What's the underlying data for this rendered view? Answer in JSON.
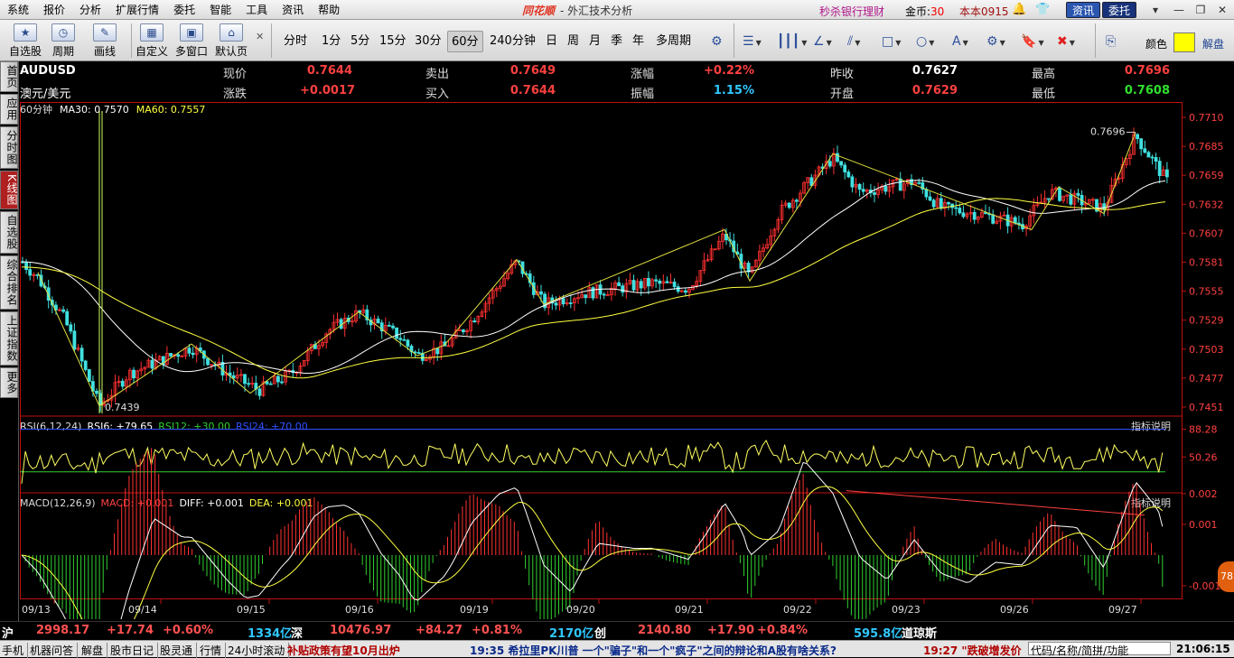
{
  "menu": {
    "items": [
      "系统",
      "报价",
      "分析",
      "扩展行情",
      "委托",
      "智能",
      "工具",
      "资讯",
      "帮助"
    ],
    "brand": "同花顺",
    "title": "- 外汇技术分析",
    "bank": "秒杀银行理财",
    "coins_label": "金币:",
    "coins_value": "30",
    "user": "本本0915",
    "btn_info": "资讯",
    "btn_trade": "委托"
  },
  "toolbar": {
    "big": [
      {
        "icon": "star-icon",
        "label": "自选股",
        "glyph": "★"
      },
      {
        "icon": "clock-icon",
        "label": "周期",
        "glyph": "◷"
      },
      {
        "icon": "pencil-icon",
        "label": "画线",
        "glyph": "✎"
      },
      {
        "icon": "grid-icon",
        "label": "自定义",
        "glyph": "▦"
      },
      {
        "icon": "windows-icon",
        "label": "多窗口",
        "glyph": "▣"
      },
      {
        "icon": "home-icon",
        "label": "默认页",
        "glyph": "⌂"
      }
    ],
    "periods": [
      "分时",
      "1分",
      "5分",
      "15分",
      "30分",
      "60分",
      "240分钟",
      "日",
      "周",
      "月",
      "季",
      "年",
      "多周期"
    ],
    "active_period": "60分",
    "color_label": "颜色",
    "color_value": "#ffff00",
    "unlock_label": "解盘"
  },
  "sidebar": [
    "首页",
    "应用",
    "分时图",
    "K线图",
    "自选股",
    "综合排名",
    "上证指数",
    "更多"
  ],
  "sidebar_active": "K线图",
  "quote": {
    "symbol": "AUDUSD",
    "name": "澳元/美元",
    "row1": [
      {
        "label": "现价",
        "value": "0.7644"
      },
      {
        "label": "卖出",
        "value": "0.7649"
      },
      {
        "label": "涨幅",
        "value": "+0.22%"
      },
      {
        "label": "昨收",
        "value": "0.7627"
      },
      {
        "label": "最高",
        "value": "0.7696"
      }
    ],
    "row2": [
      {
        "label": "涨跌",
        "value": "+0.0017"
      },
      {
        "label": "买入",
        "value": "0.7644"
      },
      {
        "label": "振幅",
        "value": "1.15%"
      },
      {
        "label": "开盘",
        "value": "0.7629"
      },
      {
        "label": "最低",
        "value": "0.7608"
      }
    ]
  },
  "main_chart": {
    "period_label": "60分钟",
    "ma30": "MA30: 0.7570",
    "ma60": "MA60: 0.7557",
    "y_ticks": [
      "0.7710",
      "0.7685",
      "0.7659",
      "0.7632",
      "0.7607",
      "0.7581",
      "0.7555",
      "0.7529",
      "0.7503",
      "0.7477",
      "0.7451"
    ],
    "high_label": "0.7696",
    "low_label": "0.7439",
    "x_ticks": [
      "09/13",
      "09/14",
      "09/15",
      "09/16",
      "09/19",
      "09/20",
      "09/21",
      "09/22",
      "09/23",
      "09/26",
      "09/27"
    ]
  },
  "rsi": {
    "title": "RSI(6,12,24)",
    "rsi6": "RSI6: +79.65",
    "rsi12": "RSI12: +30.00",
    "rsi24": "RSI24: +70.00",
    "y_ticks": [
      "88.28",
      "50.26"
    ],
    "explain": "指标说明"
  },
  "macd": {
    "title": "MACD(12,26,9)",
    "macd": "MACD: +0.001",
    "diff": "DIFF: +0.001",
    "dea": "DEA: +0.001",
    "y_ticks": [
      "0.002",
      "0.001",
      "-0.001"
    ],
    "explain": "指标说明"
  },
  "chart_data": {
    "type": "candlestick",
    "x_ticks": [
      "09/13",
      "09/14",
      "09/15",
      "09/16",
      "09/19",
      "09/20",
      "09/21",
      "09/22",
      "09/23",
      "09/26",
      "09/27"
    ],
    "ylim": [
      0.7439,
      0.771
    ],
    "high": 0.7696,
    "low": 0.7439,
    "ma30": 0.757,
    "ma60": 0.7557,
    "rsi_levels": [
      88.28,
      50.26
    ],
    "macd_levels": [
      0.002,
      0.001,
      -0.001
    ]
  },
  "ticker": [
    {
      "t": "沪",
      "c": "#fff"
    },
    {
      "t": "2998.17",
      "c": "#ff5050"
    },
    {
      "t": "+17.74",
      "c": "#ff5050"
    },
    {
      "t": "+0.60%",
      "c": "#ff5050"
    },
    {
      "t": "1334亿",
      "c": "#30c8ff"
    },
    {
      "t": "深",
      "c": "#fff"
    },
    {
      "t": "10476.97",
      "c": "#ff5050"
    },
    {
      "t": "+84.27",
      "c": "#ff5050"
    },
    {
      "t": "+0.81%",
      "c": "#ff5050"
    },
    {
      "t": "2170亿",
      "c": "#30c8ff"
    },
    {
      "t": "创",
      "c": "#fff"
    },
    {
      "t": "2140.80",
      "c": "#ff5050"
    },
    {
      "t": "+17.90",
      "c": "#ff5050"
    },
    {
      "t": "+0.84%",
      "c": "#ff5050"
    },
    {
      "t": "595.8亿",
      "c": "#30c8ff"
    },
    {
      "t": "道琼斯",
      "c": "#fff"
    }
  ],
  "status": {
    "items": [
      "手机",
      "机器问答",
      "解盘",
      "股市日记",
      "股灵通",
      "行情",
      "24小时滚动"
    ],
    "news1": "补贴政策有望10月出炉",
    "news2": "19:35 希拉里PK川普 一个\"骗子\"和一个\"疯子\"之间的辩论和A股有啥关系?",
    "news3": "19:27 \"跌破增发价",
    "search": "代码/名称/简拼/功能",
    "clock": "21:06:15"
  },
  "float_badge": "78"
}
